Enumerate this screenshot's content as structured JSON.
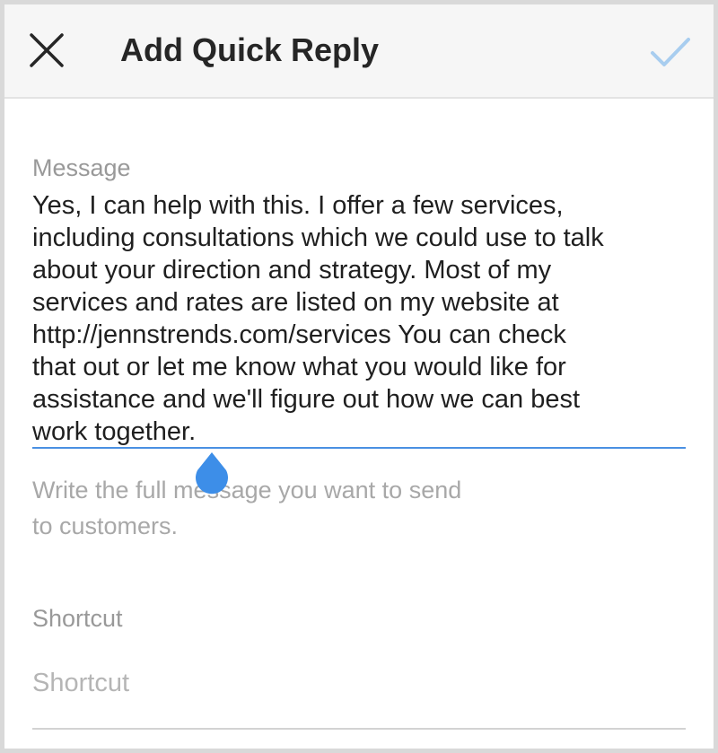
{
  "header": {
    "title": "Add Quick Reply",
    "close_icon": "close-icon",
    "confirm_icon": "checkmark-icon",
    "confirm_color": "#a8cdef"
  },
  "message": {
    "label": "Message",
    "value": "Yes, I can help with this. I offer a few services,\nincluding consultations which we could use to talk\nabout your direction and strategy. Most of my\nservices and rates are listed on my website at\nhttp://jennstrends.com/services You can check\nthat out or let me know what you would like for\nassistance and we'll figure out how we can best\nwork together.",
    "helper": "Write the full message you want to send\nto customers.",
    "accent_color": "#4a90e2"
  },
  "shortcut": {
    "label": "Shortcut",
    "placeholder": "Shortcut",
    "value": ""
  }
}
